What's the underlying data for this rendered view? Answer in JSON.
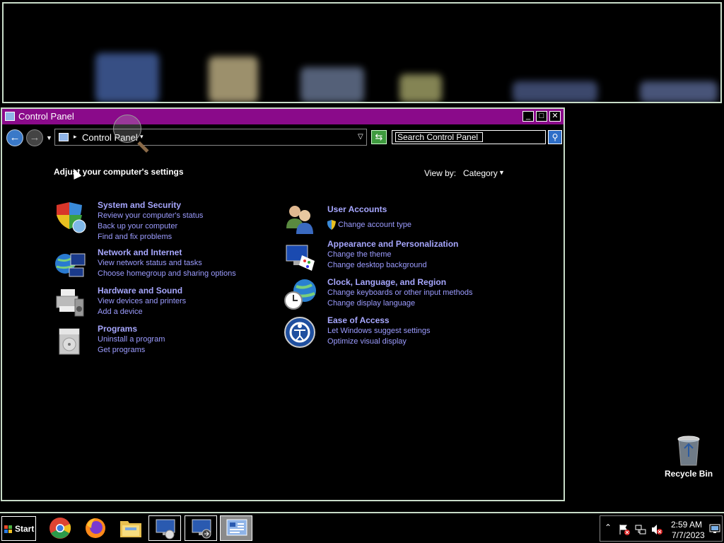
{
  "window": {
    "title": "Control Panel",
    "address": "Control Panel",
    "search_placeholder": "Search Control Panel",
    "heading": "Adjust your computer's settings",
    "view_by_label": "View by:",
    "view_by_value": "Category"
  },
  "categories_left": [
    {
      "title": "System and Security",
      "icon": "shield-icon",
      "links": [
        "Review your computer's status",
        "Back up your computer",
        "Find and fix problems"
      ]
    },
    {
      "title": "Network and Internet",
      "icon": "network-globe-icon",
      "links": [
        "View network status and tasks",
        "Choose homegroup and sharing options"
      ]
    },
    {
      "title": "Hardware and Sound",
      "icon": "printer-speaker-icon",
      "links": [
        "View devices and printers",
        "Add a device"
      ]
    },
    {
      "title": "Programs",
      "icon": "programs-box-icon",
      "links": [
        "Uninstall a program",
        "Get programs"
      ]
    }
  ],
  "categories_right": [
    {
      "title": "User Accounts",
      "icon": "users-icon",
      "links": [
        "Change account type"
      ]
    },
    {
      "title": "Appearance and Personalization",
      "icon": "monitor-palette-icon",
      "links": [
        "Change the theme",
        "Change desktop background"
      ]
    },
    {
      "title": "Clock, Language, and Region",
      "icon": "clock-globe-icon",
      "links": [
        "Change keyboards or other input methods",
        "Change display language"
      ]
    },
    {
      "title": "Ease of Access",
      "icon": "ease-of-access-icon",
      "links": [
        "Let Windows suggest settings",
        "Optimize visual display"
      ]
    }
  ],
  "desktop": {
    "recycle_bin_label": "Recycle Bin"
  },
  "taskbar": {
    "start_label": "Start",
    "pinned": [
      "chrome-icon",
      "firefox-icon",
      "file-explorer-icon",
      "remote-desktop-icon",
      "network-connection-icon",
      "control-panel-icon"
    ],
    "clock_time": "2:59 AM",
    "clock_date": "7/7/2023"
  },
  "colors": {
    "titlebar": "#8a0a8a",
    "link": "#9c9cff",
    "border": "#c8dcc8"
  }
}
